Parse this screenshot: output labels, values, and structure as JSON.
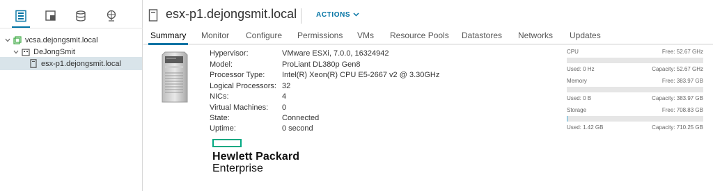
{
  "navigator": {
    "icons": [
      {
        "name": "hosts-clusters-icon",
        "active": true
      },
      {
        "name": "vms-templates-icon",
        "active": false
      },
      {
        "name": "storage-icon",
        "active": false
      },
      {
        "name": "networking-icon",
        "active": false
      }
    ],
    "tree": [
      {
        "label": "vcsa.dejongsmit.local",
        "expanded": true
      },
      {
        "label": "DeJongSmit",
        "expanded": true
      },
      {
        "label": "esx-p1.dejongsmit.local",
        "selected": true
      }
    ]
  },
  "header": {
    "title": "esx-p1.dejongsmit.local",
    "actions_label": "ACTIONS"
  },
  "tabs": [
    "Summary",
    "Monitor",
    "Configure",
    "Permissions",
    "VMs",
    "Resource Pools",
    "Datastores",
    "Networks",
    "Updates"
  ],
  "summary": {
    "properties": [
      {
        "label": "Hypervisor:",
        "value": "VMware ESXi, 7.0.0, 16324942"
      },
      {
        "label": "Model:",
        "value": "ProLiant DL380p Gen8"
      },
      {
        "label": "Processor Type:",
        "value": "Intel(R) Xeon(R) CPU E5-2667 v2 @ 3.30GHz"
      },
      {
        "label": "Logical Processors:",
        "value": "32"
      },
      {
        "label": "NICs:",
        "value": "4"
      },
      {
        "label": "Virtual Machines:",
        "value": "0"
      },
      {
        "label": "State:",
        "value": "Connected"
      },
      {
        "label": "Uptime:",
        "value": "0 second"
      }
    ],
    "vendor_logo": {
      "line1": "Hewlett Packard",
      "line2": "Enterprise",
      "accent": "#01a982"
    }
  },
  "resources": [
    {
      "name": "CPU",
      "free": "Free: 52.67 GHz",
      "used": "Used: 0 Hz",
      "capacity": "Capacity: 52.67 GHz",
      "used_fraction": 0.0
    },
    {
      "name": "Memory",
      "free": "Free: 383.97 GB",
      "used": "Used: 0 B",
      "capacity": "Capacity: 383.97 GB",
      "used_fraction": 0.0
    },
    {
      "name": "Storage",
      "free": "Free: 708.83 GB",
      "used": "Used: 1.42 GB",
      "capacity": "Capacity: 710.25 GB",
      "used_fraction": 0.002
    }
  ],
  "colors": {
    "accent": "#0072a3",
    "meter_fill": "#49afd9",
    "selected_row": "#d9e4ea"
  }
}
